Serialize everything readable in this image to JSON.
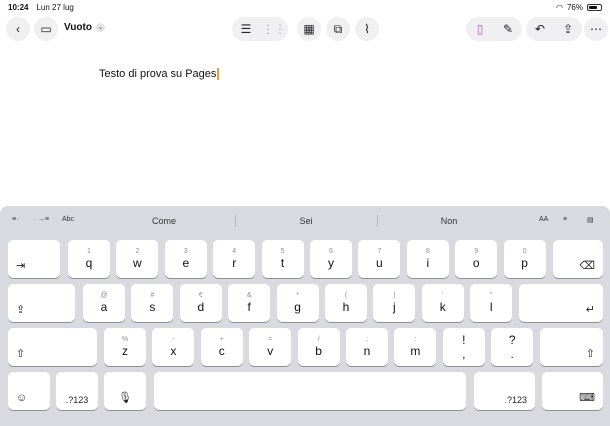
{
  "status": {
    "time": "10:24",
    "date": "Lun 27 lug",
    "battery": "76%",
    "battery_level": 0.76
  },
  "toolbar": {
    "title": "Vuoto",
    "title_chevron": "chevron-down-icon"
  },
  "document": {
    "body": "Testo di prova su Pages"
  },
  "quicktype": {
    "suggestions": [
      "Come",
      "Sei",
      "Non"
    ],
    "abc": "Abc",
    "aa": "AA"
  },
  "keys": {
    "row1": [
      [
        "1",
        "q"
      ],
      [
        "2",
        "w"
      ],
      [
        "3",
        "e"
      ],
      [
        "4",
        "r"
      ],
      [
        "5",
        "t"
      ],
      [
        "6",
        "y"
      ],
      [
        "7",
        "u"
      ],
      [
        "8",
        "i"
      ],
      [
        "9",
        "o"
      ],
      [
        "0",
        "p"
      ]
    ],
    "row2": [
      [
        "@",
        "a"
      ],
      [
        "#",
        "s"
      ],
      [
        "€",
        "d"
      ],
      [
        "&",
        "f"
      ],
      [
        "*",
        "g"
      ],
      [
        "(",
        "h"
      ],
      [
        ")",
        "j"
      ],
      [
        "'",
        "k"
      ],
      [
        "\"",
        "l"
      ]
    ],
    "row3": [
      [
        "%",
        "z"
      ],
      [
        "-",
        "x"
      ],
      [
        "+",
        "c"
      ],
      [
        "=",
        "v"
      ],
      [
        "/",
        "b"
      ],
      [
        ";",
        "n"
      ],
      [
        ":",
        "m"
      ],
      [
        "",
        "!"
      ],
      [
        "",
        "?"
      ]
    ],
    "row3_sub": [
      ",",
      "."
    ],
    "numbers_label": ".?123"
  },
  "colors": {
    "caret": "#f09a3e",
    "keyboard_bg": "#d8dadf"
  }
}
